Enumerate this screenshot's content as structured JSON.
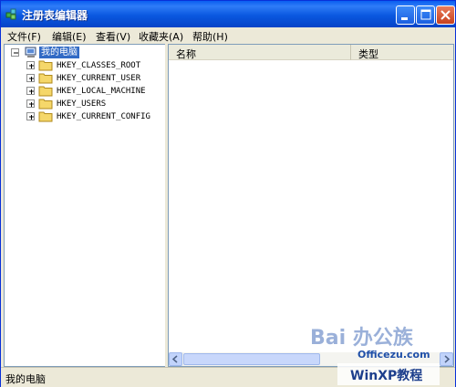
{
  "window": {
    "title": "注册表编辑器"
  },
  "menu": [
    "文件(F)",
    "编辑(E)",
    "查看(V)",
    "收藏夹(A)",
    "帮助(H)"
  ],
  "tree": {
    "root": "我的电脑",
    "keys": [
      "HKEY_CLASSES_ROOT",
      "HKEY_CURRENT_USER",
      "HKEY_LOCAL_MACHINE",
      "HKEY_USERS",
      "HKEY_CURRENT_CONFIG"
    ]
  },
  "list": {
    "columns": [
      "名称",
      "类型"
    ]
  },
  "status": {
    "text": "我的电脑"
  },
  "watermarks": {
    "baidu": "Bai 办公族",
    "officezu": "Officezu.com",
    "winxp": "WinXP教程"
  },
  "colors": {
    "title_bar": "#0a58e0",
    "selection": "#316ac5",
    "chrome": "#ece9d8"
  },
  "icons": [
    "registry-app-icon",
    "minimize-icon",
    "maximize-icon",
    "close-icon",
    "computer-icon",
    "folder-icon",
    "expand-plus-icon",
    "collapse-minus-icon"
  ]
}
